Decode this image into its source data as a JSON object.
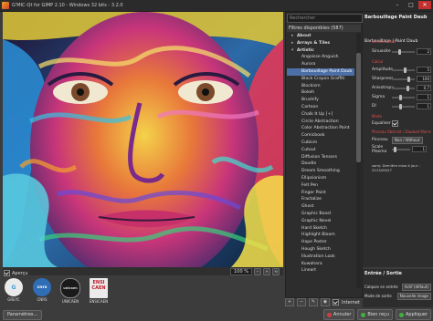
{
  "window": {
    "title": "G'MIC-Qt for GIMP 2.10 - Windows 32 bits - 3.2.0",
    "controls": [
      "–",
      "□",
      "✕"
    ]
  },
  "preview": {
    "zoom": "100 %",
    "apercu_label": "Aperçu"
  },
  "logos": [
    {
      "name": "GREYC",
      "mark": "G",
      "color": "#3a9ad9"
    },
    {
      "name": "CNRS",
      "mark": "cnrs",
      "color": "#2f6db5"
    },
    {
      "name": "UNICAEN",
      "mark": "unicaen",
      "color": "#222222"
    },
    {
      "name": "ENSICAEN",
      "mark": "ENSI CAEN",
      "color": "#c01a2a"
    }
  ],
  "params_button": "Paramètres...",
  "filters": {
    "search_placeholder": "Rechercher",
    "header": "Filtres disponibles (587)",
    "items": [
      {
        "label": "About",
        "kind": "folder"
      },
      {
        "label": "Arrays & Tiles",
        "kind": "folder"
      },
      {
        "label": "Artistic",
        "kind": "folder-open"
      },
      {
        "label": "Angoisse Anguish",
        "kind": "leaf"
      },
      {
        "label": "Aurora",
        "kind": "leaf"
      },
      {
        "label": "Barbouillage Paint Daub",
        "kind": "leaf",
        "selected": true
      },
      {
        "label": "Black Crayon Graffiti",
        "kind": "leaf"
      },
      {
        "label": "Blockism",
        "kind": "leaf"
      },
      {
        "label": "Bokeh",
        "kind": "leaf"
      },
      {
        "label": "Brushify",
        "kind": "leaf"
      },
      {
        "label": "Cartoon",
        "kind": "leaf"
      },
      {
        "label": "Chalk It Up [+]",
        "kind": "leaf"
      },
      {
        "label": "Circle Abstraction",
        "kind": "leaf"
      },
      {
        "label": "Color Abstraction Paint",
        "kind": "leaf"
      },
      {
        "label": "Comicbook",
        "kind": "leaf"
      },
      {
        "label": "Cubism",
        "kind": "leaf"
      },
      {
        "label": "Cutout",
        "kind": "leaf"
      },
      {
        "label": "Diffusion Tensors",
        "kind": "leaf"
      },
      {
        "label": "Doodle",
        "kind": "leaf"
      },
      {
        "label": "Dream Smoothing",
        "kind": "leaf"
      },
      {
        "label": "Ellipsionism",
        "kind": "leaf"
      },
      {
        "label": "Felt Pen",
        "kind": "leaf"
      },
      {
        "label": "Finger Paint",
        "kind": "leaf"
      },
      {
        "label": "Fractalize",
        "kind": "leaf"
      },
      {
        "label": "Ghost",
        "kind": "leaf"
      },
      {
        "label": "Graphic Boost",
        "kind": "leaf"
      },
      {
        "label": "Graphic Novel",
        "kind": "leaf"
      },
      {
        "label": "Hard Sketch",
        "kind": "leaf"
      },
      {
        "label": "Highlight Bloom",
        "kind": "leaf"
      },
      {
        "label": "Hope Poster",
        "kind": "leaf"
      },
      {
        "label": "Hough Sketch",
        "kind": "leaf"
      },
      {
        "label": "Illustration Look",
        "kind": "leaf"
      },
      {
        "label": "Kuwahara",
        "kind": "leaf"
      },
      {
        "label": "Lineart",
        "kind": "leaf"
      }
    ],
    "internet_label": "Internet"
  },
  "settings": {
    "title": "Barbouillage Paint Daub",
    "subtitle": "Barbouillage | Paint Daub",
    "sections": {
      "general": "Gestion Nom",
      "repeat": "Calcul",
      "mode": "Mode",
      "credit_section": "Pinceau Abstrait / Daubed Marre"
    },
    "params": [
      {
        "label": "Sinuosite",
        "value": "2",
        "level": 0.3
      },
      {
        "label": "Amplitude",
        "value": "5",
        "level": 0.55
      },
      {
        "label": "Sharpness",
        "value": "100",
        "level": 0.75
      },
      {
        "label": "Anisotropy",
        "value": "0.7",
        "level": 0.7
      },
      {
        "label": "Sigma",
        "value": "1",
        "level": 0.35
      },
      {
        "label": "Dl",
        "value": "1",
        "level": 0.35
      }
    ],
    "equalize_label": "Equaliser",
    "pinceau_label": "Pinceau",
    "pinceau_value": "Non / Without",
    "scale_label": "Scale Plasma",
    "scale_value": "1",
    "credit": "samj: Dernière mise à jour : 2013/09/27"
  },
  "io": {
    "header": "Entrée / Sortie",
    "rows": [
      {
        "label": "Calques en entrée",
        "value": "Actif (défaut)"
      },
      {
        "label": "Mode de sortie",
        "value": "Nouvelle image"
      }
    ]
  },
  "buttons": {
    "cancel": "Annuler",
    "ok": "Bien reçu",
    "apply": "Appliquer"
  },
  "colors": {
    "accent": "#4d6fa8",
    "section_red": "#e05050",
    "close_red": "#c23030"
  }
}
